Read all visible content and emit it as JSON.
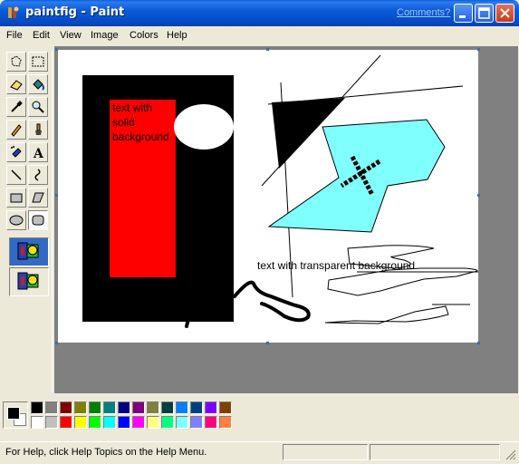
{
  "window": {
    "title": "paintfig - Paint",
    "comments_link": "Comments?"
  },
  "menu": [
    "File",
    "Edit",
    "View",
    "Image",
    "Colors",
    "Help"
  ],
  "tools": [
    "free-form-select",
    "rectangle-select",
    "eraser",
    "fill-with-color",
    "pick-color",
    "magnifier",
    "pencil",
    "brush",
    "airbrush",
    "text",
    "line",
    "curve",
    "rectangle",
    "polygon",
    "ellipse",
    "rounded-rectangle"
  ],
  "canvas": {
    "text_solid_lines": [
      "text with",
      "solid",
      "background"
    ],
    "text_transparent": "text with transparent background"
  },
  "palette": {
    "foreground": "#000000",
    "background": "#ffffff",
    "row1": [
      "#000000",
      "#808080",
      "#800000",
      "#808000",
      "#008000",
      "#008080",
      "#000080",
      "#800080",
      "#808040",
      "#004040",
      "#0080FF",
      "#004080",
      "#8000FF",
      "#804000"
    ],
    "row2": [
      "#FFFFFF",
      "#C0C0C0",
      "#FF0000",
      "#FFFF00",
      "#00FF00",
      "#00FFFF",
      "#0000FF",
      "#FF00FF",
      "#FFFF80",
      "#00FF80",
      "#80FFFF",
      "#8080FF",
      "#FF0080",
      "#FF8040"
    ]
  },
  "status": {
    "help_text": "For Help, click Help Topics on the Help Menu."
  }
}
